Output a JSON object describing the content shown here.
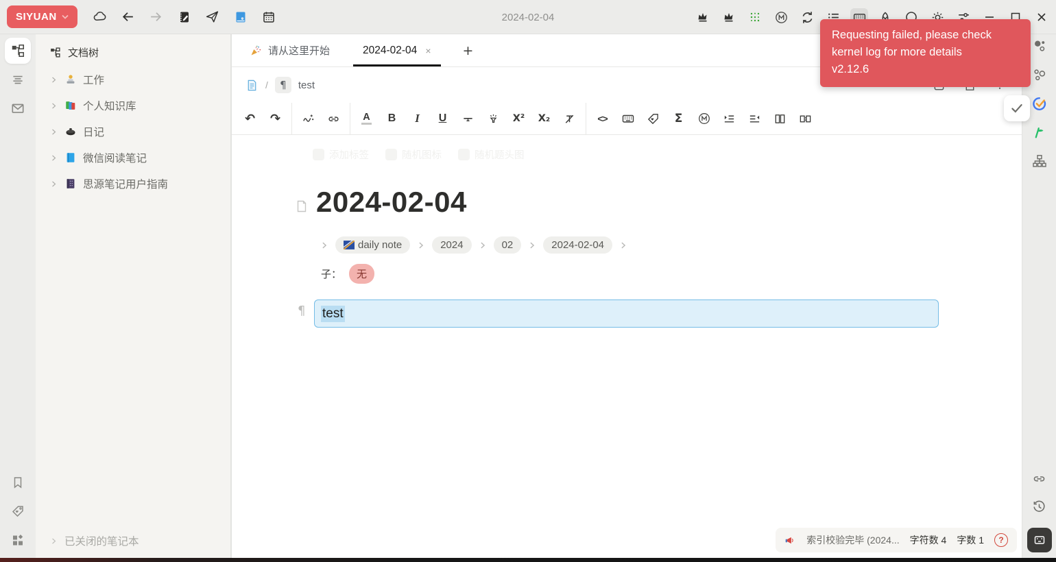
{
  "topbar": {
    "brand": "SIYUAN",
    "center_title": "2024-02-04",
    "nav_icons": [
      "cloud-icon",
      "back-arrow-icon",
      "forward-arrow-icon",
      "notebook-pencil-icon",
      "paper-plane-icon",
      "blue-book-icon",
      "calendar-icon"
    ],
    "right_icons": [
      "crown-icon",
      "crown-icon-2",
      "green-dots-grid-icon",
      "m-circle-icon",
      "sync-icon",
      "list-icon",
      "keyboard-icon",
      "ribbon-icon",
      "circle-icon",
      "brightness-icon",
      "sliders-icon",
      "minimize-icon",
      "maximize-icon",
      "close-icon"
    ],
    "active_right_icon": "keyboard-icon"
  },
  "toast": {
    "lines": [
      "Requesting failed, please check",
      "kernel log for more details",
      "v2.12.6"
    ],
    "bg_color": "#e0575c"
  },
  "dock_left": {
    "top_icons": [
      "file-tree-icon",
      "outline-icon",
      "inbox-icon"
    ],
    "bottom_icons": [
      "bookmark-icon",
      "tag-icon",
      "blocks-icon"
    ],
    "active_icon": "file-tree-icon"
  },
  "sidebar": {
    "header": "文档树",
    "items": [
      {
        "icon": "person-laptop",
        "label": "工作"
      },
      {
        "icon": "books",
        "label": "个人知识库"
      },
      {
        "icon": "curling-stone",
        "label": "日记"
      },
      {
        "icon": "blue-book",
        "label": "微信阅读笔记"
      },
      {
        "icon": "purple-guide-book",
        "label": "思源笔记用户指南"
      }
    ],
    "closed_notebooks": "已关闭的笔记本"
  },
  "tabs": {
    "items": [
      {
        "icon": "party-popper-icon",
        "label": "请从这里开始",
        "active": false
      },
      {
        "label": "2024-02-04",
        "close_glyph": "×",
        "active": true
      }
    ],
    "new_tab_glyph": "+"
  },
  "breadcrumb": {
    "doc_icon": "document-icon",
    "separator": "/",
    "block_glyph": "¶",
    "label": "test",
    "right_icons": [
      "focus-icon",
      "open-window-icon",
      "more-icon"
    ]
  },
  "toolbar": {
    "items": [
      {
        "name": "undo",
        "glyph": "↶"
      },
      {
        "name": "redo",
        "glyph": "↷"
      },
      {
        "name": "divider"
      },
      {
        "name": "ai-wand"
      },
      {
        "name": "inline-link"
      },
      {
        "name": "divider"
      },
      {
        "name": "font-color",
        "glyph": "A"
      },
      {
        "name": "bold",
        "glyph": "B"
      },
      {
        "name": "italic",
        "glyph": "I"
      },
      {
        "name": "underline",
        "glyph": "U"
      },
      {
        "name": "strikethrough"
      },
      {
        "name": "highlight-mark"
      },
      {
        "name": "superscript",
        "glyph": "X²"
      },
      {
        "name": "subscript",
        "glyph": "X₂"
      },
      {
        "name": "clear-format"
      },
      {
        "name": "divider"
      },
      {
        "name": "inline-code",
        "glyph": "<>"
      },
      {
        "name": "kbd"
      },
      {
        "name": "inline-tag"
      },
      {
        "name": "math",
        "glyph": "Σ"
      },
      {
        "name": "memo"
      },
      {
        "name": "indent"
      },
      {
        "name": "outdent"
      },
      {
        "name": "columns"
      },
      {
        "name": "block-transfer"
      }
    ]
  },
  "editor": {
    "ghost_buttons": [
      "添加标签",
      "随机图标",
      "随机题头图"
    ],
    "title": "2024-02-04",
    "path_chips": [
      {
        "icon": "flag-icon",
        "label": "daily note"
      },
      {
        "label": "2024"
      },
      {
        "label": "02"
      },
      {
        "label": "2024-02-04"
      }
    ],
    "child_label": "子：",
    "child_value": "无",
    "block_glyph": "¶",
    "block_text": "test",
    "selection_colors": {
      "background": "#def0fa",
      "border": "#74bce6",
      "text_highlight": "#b9ddf2"
    }
  },
  "statusbar": {
    "message_icon": "megaphone-icon",
    "message": "索引校验完毕 (2024...",
    "char_count": "字符数 4",
    "word_count": "字数 1",
    "help_glyph": "?"
  },
  "dock_right": {
    "top_icons": [
      "graph-dots-icon",
      "graph-circles-icon",
      "check-plugin-icon",
      "green-plugin-icon",
      "org-tree-icon"
    ],
    "bottom_icons": [
      "backlinks-icon",
      "history-icon",
      "inline-frame-button"
    ]
  },
  "confirm_button": {
    "icon": "check-icon"
  },
  "colors": {
    "brand": "#e85d60",
    "topbar_bg": "#ececea",
    "sidebar_bg": "#f5f4f1",
    "pink_chip_bg": "#f3b2ae",
    "pink_chip_text": "#86362f"
  }
}
